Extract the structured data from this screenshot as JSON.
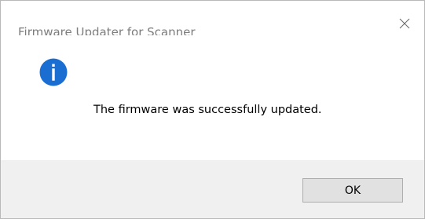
{
  "window": {
    "title": "Firmware Updater for Scanner",
    "close_icon": "close-icon"
  },
  "message": {
    "icon": "info-icon",
    "text": "The firmware was successfully updated."
  },
  "buttons": {
    "ok_label": "OK"
  },
  "colors": {
    "info_icon": "#1b6ed1",
    "footer_bg": "#f0f0f0",
    "button_bg": "#e1e1e1",
    "button_border": "#adadad",
    "title_text": "#7d7d7d"
  }
}
